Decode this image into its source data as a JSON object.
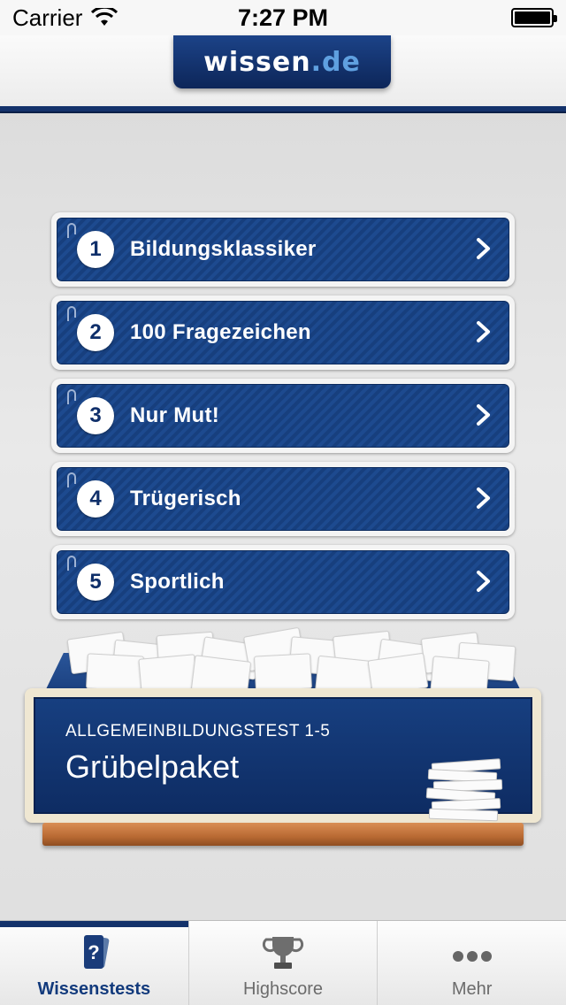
{
  "status_bar": {
    "carrier": "Carrier",
    "time": "7:27 PM",
    "battery": "100%"
  },
  "header": {
    "logo_main": "wissen",
    "logo_ext": ".de"
  },
  "quizzes": [
    {
      "number": "1",
      "title": "Bildungsklassiker"
    },
    {
      "number": "2",
      "title": "100 Fragezeichen"
    },
    {
      "number": "3",
      "title": "Nur Mut!"
    },
    {
      "number": "4",
      "title": "Trügerisch"
    },
    {
      "number": "5",
      "title": "Sportlich"
    }
  ],
  "package": {
    "subtitle": "ALLGEMEINBILDUNGSTEST 1-5",
    "title": "Grübelpaket"
  },
  "tabs": [
    {
      "label": "Wissenstests",
      "icon": "cards-question-icon",
      "active": true
    },
    {
      "label": "Highscore",
      "icon": "trophy-icon",
      "active": false
    },
    {
      "label": "Mehr",
      "icon": "more-dots-icon",
      "active": false
    }
  ],
  "colors": {
    "brand_blue": "#14326b",
    "button_blue": "#1d4a8f",
    "shelf_wood": "#c87a40"
  }
}
